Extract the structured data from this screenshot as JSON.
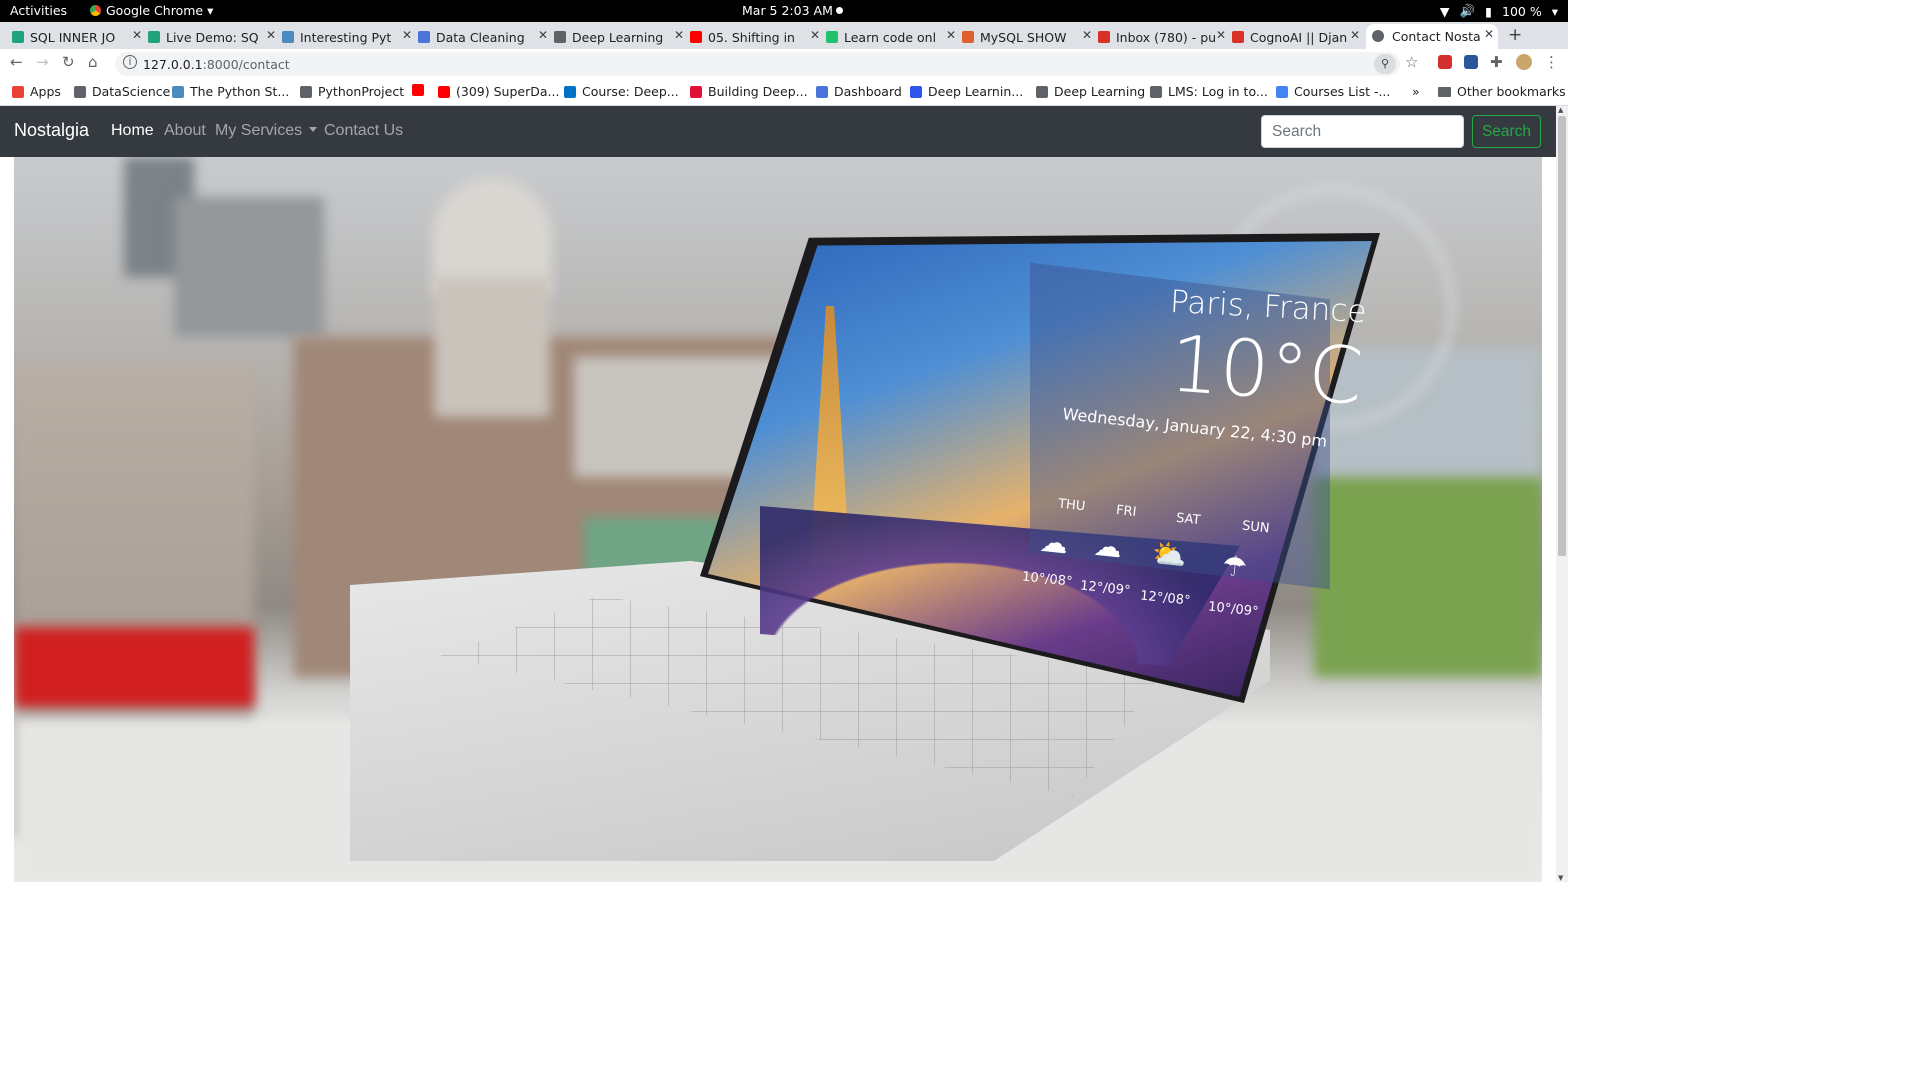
{
  "os_bar": {
    "activities": "Activities",
    "app_name": "Google Chrome",
    "clock": "Mar 5  2:03 AM",
    "battery": "100 %"
  },
  "tabs": [
    {
      "label": "SQL INNER JO",
      "color": "#20a37c"
    },
    {
      "label": "Live Demo: SQ",
      "color": "#20a37c"
    },
    {
      "label": "Interesting Pyt",
      "color": "#4b8bbe"
    },
    {
      "label": "Data Cleaning",
      "color": "#4a74d9"
    },
    {
      "label": "Deep Learning",
      "color": "#5f6368"
    },
    {
      "label": "05. Shifting in",
      "color": "#ff0000"
    },
    {
      "label": "Learn code onl",
      "color": "#1fc16b"
    },
    {
      "label": "MySQL SHOW",
      "color": "#e05f2f"
    },
    {
      "label": "Inbox (780) - pu",
      "color": "#d93025"
    },
    {
      "label": "CognoAI || Djan",
      "color": "#d93025"
    },
    {
      "label": "Contact Nosta",
      "color": "#5f6368",
      "active": true
    }
  ],
  "toolbar": {
    "url_host": "127.0.0.1",
    "url_path": ":8000/contact"
  },
  "bookmarks": [
    {
      "label": "Apps",
      "color": "#ea4335"
    },
    {
      "label": "DataScience",
      "color": "#5f6368"
    },
    {
      "label": "The Python St...",
      "color": "#4b8bbe"
    },
    {
      "label": "PythonProject",
      "color": "#5f6368"
    },
    {
      "label": "",
      "color": "#ff0000"
    },
    {
      "label": "(309) SuperDa...",
      "color": "#ff0000"
    },
    {
      "label": "Course: Deep...",
      "color": "#0071c5"
    },
    {
      "label": "Building Deep...",
      "color": "#e0123a"
    },
    {
      "label": "Dashboard",
      "color": "#4a74d9"
    },
    {
      "label": "Deep Learnin...",
      "color": "#2f54eb"
    },
    {
      "label": "Deep Learning",
      "color": "#5f6368"
    },
    {
      "label": "LMS: Log in to...",
      "color": "#5f6368"
    },
    {
      "label": "Courses List -...",
      "color": "#4285f4"
    }
  ],
  "bookmarks_more": "»",
  "other_bookmarks": "Other bookmarks",
  "navbar": {
    "brand": "Nostalgia",
    "links": [
      "Home",
      "About",
      "My Services",
      "Contact Us"
    ],
    "active_index": 0,
    "search_placeholder": "Search",
    "search_button": "Search"
  },
  "hero": {
    "weather_city": "Paris, France",
    "weather_temp": "10°C",
    "weather_date": "Wednesday, January 22, 4:30 pm",
    "days": [
      "THU",
      "FRI",
      "SAT",
      "SUN"
    ],
    "temps": [
      "10°/08°",
      "12°/09°",
      "12°/08°",
      "10°/09°"
    ],
    "icons": [
      "storm-icon",
      "cloud-icon",
      "sun-cloud-icon",
      "rain-icon"
    ]
  }
}
